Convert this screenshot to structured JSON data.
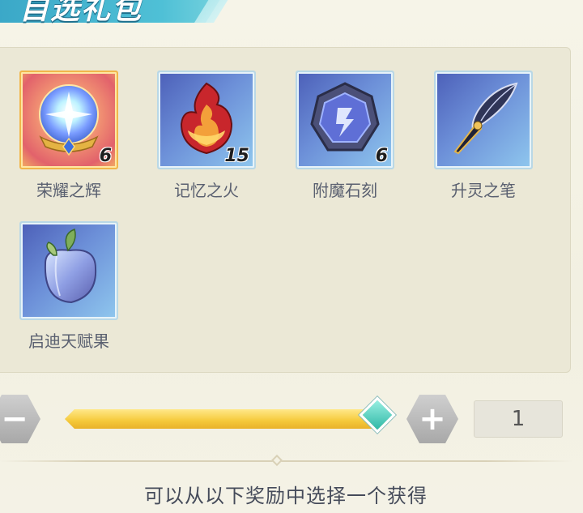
{
  "header": {
    "title": "自选礼包"
  },
  "rewards": [
    {
      "name": "荣耀之辉",
      "count": "6",
      "icon": "crystal-orb-icon"
    },
    {
      "name": "记忆之火",
      "count": "15",
      "icon": "flame-icon"
    },
    {
      "name": "附魔石刻",
      "count": "6",
      "icon": "rune-stone-icon"
    },
    {
      "name": "升灵之笔",
      "count": "",
      "icon": "quill-pen-icon"
    },
    {
      "name": "启迪天赋果",
      "count": "",
      "icon": "talent-fruit-icon"
    }
  ],
  "quantity": {
    "minus_label": "−",
    "plus_label": "+",
    "value": "1",
    "slider_fraction": 0.99
  },
  "footer": {
    "hint": "可以从以下奖励中选择一个获得"
  },
  "colors": {
    "accent": "#3aa7c7",
    "slider_fill": "#f5c93a",
    "thumb": "#2fb8a6"
  }
}
